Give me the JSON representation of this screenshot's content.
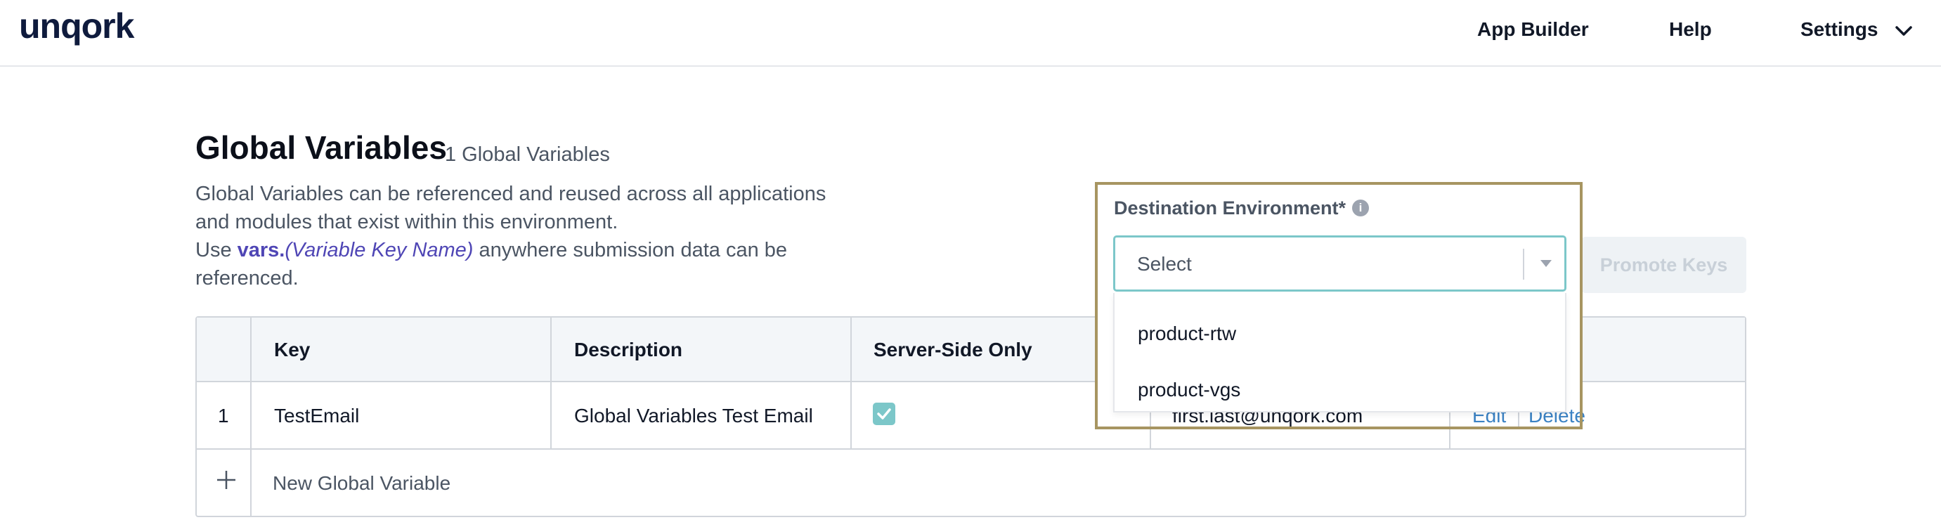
{
  "header": {
    "logo": "unqork",
    "nav": [
      "App Builder",
      "Help",
      "Settings"
    ]
  },
  "page": {
    "title": "Global Variables",
    "count": "1 Global Variables",
    "desc_line1": "Global Variables can be referenced and reused across all applications",
    "desc_line2": "and modules that exist within this environment.",
    "desc_use": "Use ",
    "desc_code": "vars.",
    "desc_code_italic": "(Variable Key Name)",
    "desc_tail": " anywhere submission data can be",
    "desc_line4": "referenced."
  },
  "table": {
    "columns": [
      "Key",
      "Description",
      "Server-Side Only"
    ],
    "rows": [
      {
        "index": "1",
        "key": "TestEmail",
        "description": "Global Variables Test Email",
        "server_side_only": true,
        "value": "first.last@unqork.com",
        "edit": "Edit",
        "delete": "Delete"
      }
    ],
    "new_label": "New Global Variable"
  },
  "promote_button": "Promote Keys",
  "destination": {
    "label": "Destination Environment*",
    "placeholder": "Select",
    "options": [
      "product-rtw",
      "product-vgs"
    ]
  },
  "colors": {
    "accent_teal": "#7cc7c9",
    "link_blue": "#3b82c4",
    "highlight_border": "#a79561",
    "code_purple": "#4f46b5"
  }
}
